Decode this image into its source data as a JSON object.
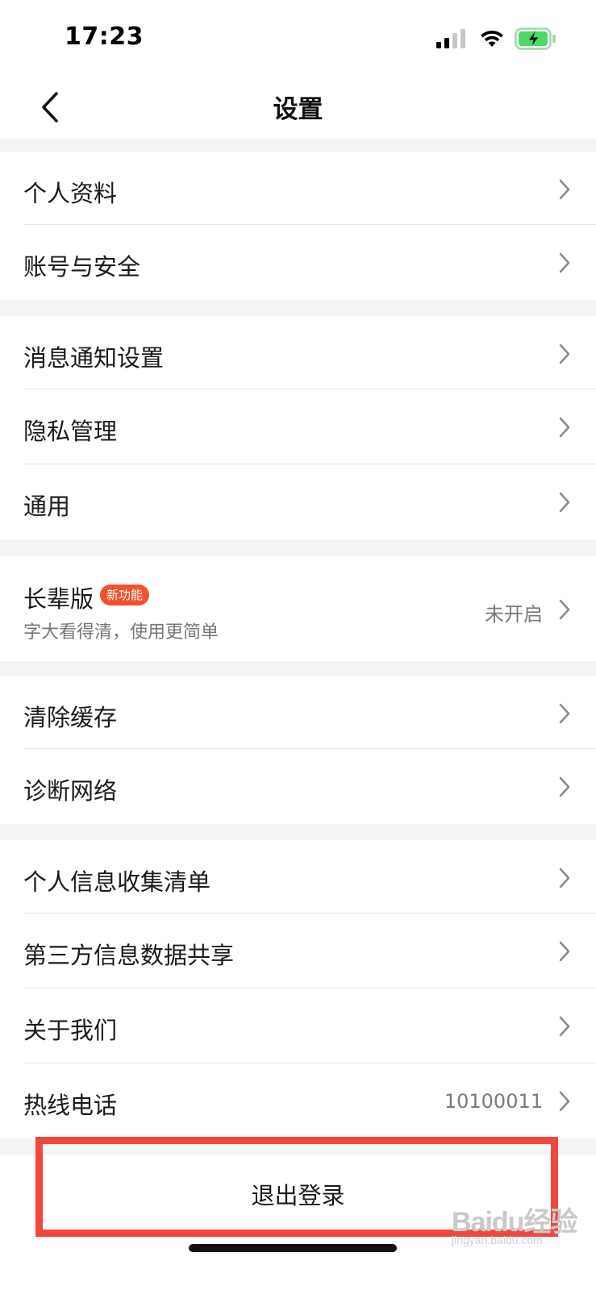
{
  "status_bar": {
    "time": "17:23",
    "icons": [
      "signal-icon",
      "wifi-icon",
      "battery-charging-icon"
    ],
    "battery_color": "#4cd964"
  },
  "nav": {
    "title": "设置",
    "back_icon": "chevron-left-icon"
  },
  "groups": [
    {
      "items": [
        {
          "label": "个人资料"
        },
        {
          "label": "账号与安全"
        }
      ]
    },
    {
      "items": [
        {
          "label": "消息通知设置"
        },
        {
          "label": "隐私管理"
        },
        {
          "label": "通用"
        }
      ]
    },
    {
      "elder": {
        "label": "长辈版",
        "badge": "新功能",
        "subtitle": "字大看得清，使用更简单",
        "value": "未开启"
      }
    },
    {
      "items": [
        {
          "label": "清除缓存"
        },
        {
          "label": "诊断网络"
        }
      ]
    },
    {
      "items": [
        {
          "label": "个人信息收集清单"
        },
        {
          "label": "第三方信息数据共享"
        },
        {
          "label": "关于我们"
        },
        {
          "label": "热线电话",
          "value": "10100011"
        }
      ]
    }
  ],
  "logout": {
    "label": "退出登录"
  },
  "highlight_color": "#f2473f",
  "badge_color": "#f2512f",
  "watermark": {
    "text": "Baidu经验",
    "sub": "jingyan.baidu.com"
  }
}
